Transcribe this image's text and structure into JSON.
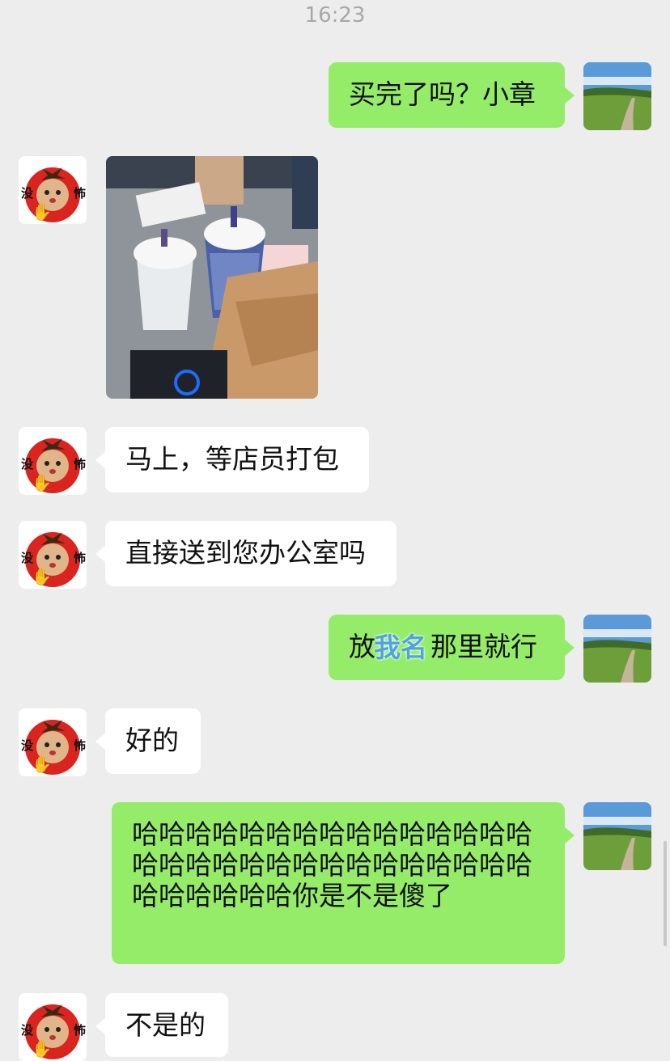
{
  "time": "16:23",
  "messages": [
    {
      "side": "right",
      "text": "买完了吗？小章"
    },
    {
      "side": "left",
      "type": "image"
    },
    {
      "side": "left",
      "text": "马上，等店员打包"
    },
    {
      "side": "left",
      "text": "直接送到您办公室吗"
    },
    {
      "side": "right",
      "text_before": "放",
      "overlay": "我名",
      "text_after": "那里就行"
    },
    {
      "side": "left",
      "text": "好的"
    },
    {
      "side": "right",
      "text": "哈哈哈哈哈哈哈哈哈哈哈哈哈哈哈哈哈哈哈哈哈哈哈哈哈哈哈哈哈哈哈哈哈哈哈哈你是不是傻了"
    },
    {
      "side": "left",
      "text": "不是的"
    }
  ],
  "left_avatar": {
    "icon": "tomato-face-avatar",
    "text_left": "没",
    "text_right": "怖",
    "colors": {
      "tomato": "#d9241f",
      "leaf": "#3a2a14"
    }
  },
  "right_avatar": {
    "icon": "landscape-path-avatar"
  },
  "colors": {
    "right_bubble": "#95ec69",
    "left_bubble": "#ffffff",
    "background": "#ededed",
    "overlay_text": "#4fa3e0"
  }
}
